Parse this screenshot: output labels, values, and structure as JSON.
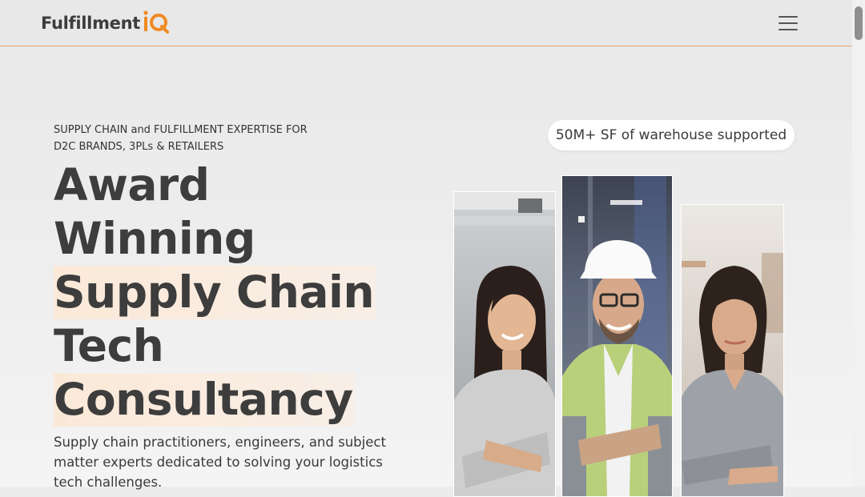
{
  "header": {
    "logo_word": "Fulfillment",
    "logo_mark": "iQ",
    "menu_icon": "hamburger-menu-icon"
  },
  "hero": {
    "eyebrow_line1": "SUPPLY CHAIN and FULFILLMENT EXPERTISE FOR",
    "eyebrow_line2": "D2C BRANDS, 3PLs & RETAILERS",
    "headline": [
      "Award",
      "Winning",
      "Supply Chain",
      "Tech",
      "Consultancy"
    ],
    "subtitle": "Supply chain practitioners, engineers, and subject matter experts dedicated to solving your logistics tech challenges.",
    "badge": "50M+ SF of warehouse supported"
  },
  "colors": {
    "accent": "#f08a24",
    "highlight": "#fbe9d8",
    "text": "#3d3d3d",
    "header_border": "#e8a36a"
  },
  "photos": [
    {
      "subject": "woman-long-hair-smiling"
    },
    {
      "subject": "man-hard-hat-safety-vest"
    },
    {
      "subject": "woman-short-hair-grey-shirt"
    }
  ]
}
